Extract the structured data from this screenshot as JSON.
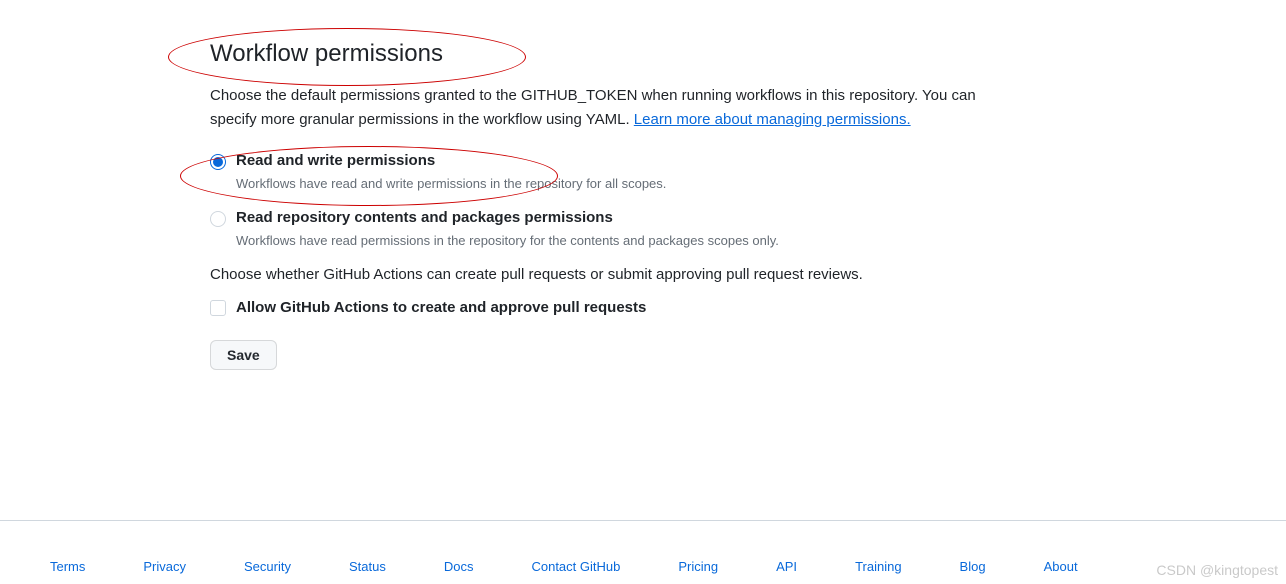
{
  "section": {
    "heading": "Workflow permissions",
    "description_text": "Choose the default permissions granted to the GITHUB_TOKEN when running workflows in this repository. You can specify more granular permissions in the workflow using YAML. ",
    "description_link": "Learn more about managing permissions."
  },
  "radio_options": [
    {
      "label": "Read and write permissions",
      "desc": "Workflows have read and write permissions in the repository for all scopes.",
      "checked": true
    },
    {
      "label": "Read repository contents and packages permissions",
      "desc": "Workflows have read permissions in the repository for the contents and packages scopes only.",
      "checked": false
    }
  ],
  "checkbox_section": {
    "description": "Choose whether GitHub Actions can create pull requests or submit approving pull request reviews.",
    "label": "Allow GitHub Actions to create and approve pull requests",
    "checked": false
  },
  "save_button": "Save",
  "footer_links": [
    "Terms",
    "Privacy",
    "Security",
    "Status",
    "Docs",
    "Contact GitHub",
    "Pricing",
    "API",
    "Training",
    "Blog",
    "About"
  ],
  "watermark": "CSDN @kingtopest"
}
